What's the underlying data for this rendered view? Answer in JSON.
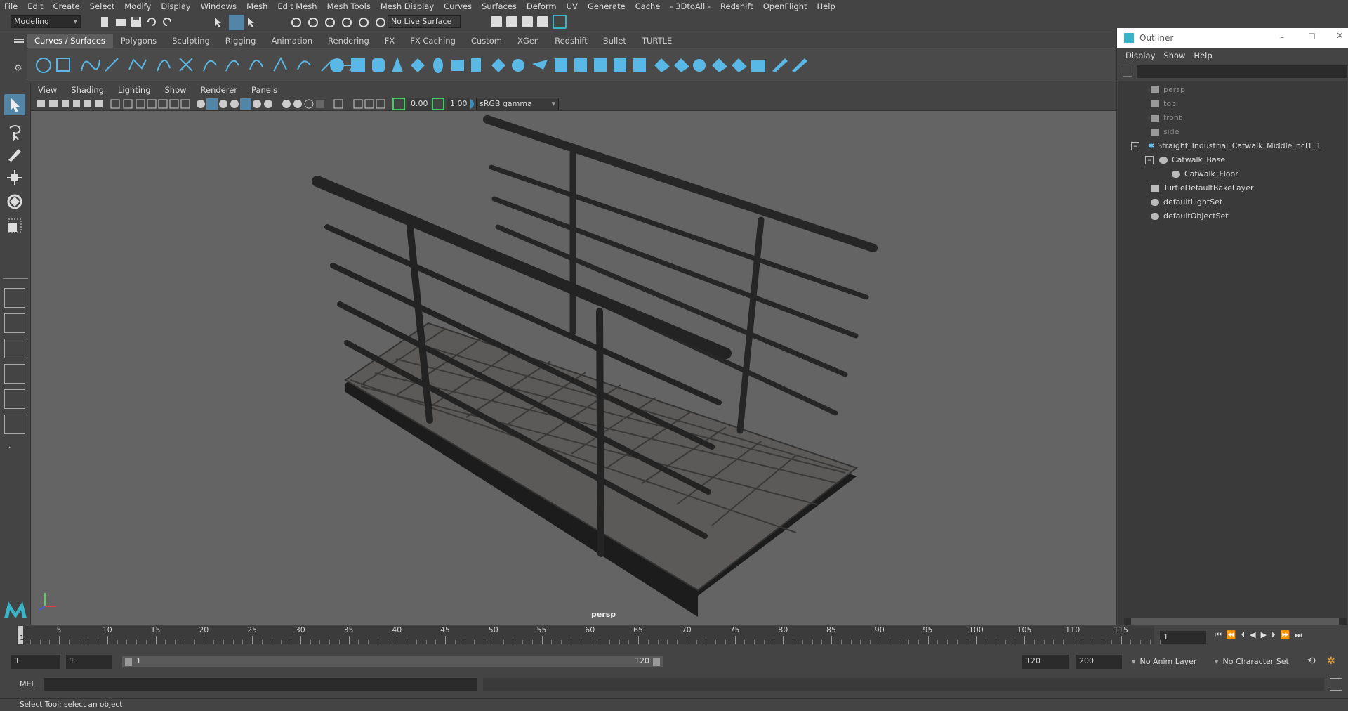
{
  "menu": [
    "File",
    "Edit",
    "Create",
    "Select",
    "Modify",
    "Display",
    "Windows",
    "Mesh",
    "Edit Mesh",
    "Mesh Tools",
    "Mesh Display",
    "Curves",
    "Surfaces",
    "Deform",
    "UV",
    "Generate",
    "Cache",
    "- 3DtoAll -",
    "Redshift",
    "OpenFlight",
    "Help"
  ],
  "status": {
    "mode": "Modeling",
    "live_surface": "No Live Surface"
  },
  "shelf_tabs": [
    "Curves / Surfaces",
    "Polygons",
    "Sculpting",
    "Rigging",
    "Animation",
    "Rendering",
    "FX",
    "FX Caching",
    "Custom",
    "XGen",
    "Redshift",
    "Bullet",
    "TURTLE"
  ],
  "shelf_active": "Curves / Surfaces",
  "viewport": {
    "menu": [
      "View",
      "Shading",
      "Lighting",
      "Show",
      "Renderer",
      "Panels"
    ],
    "exposure": "0.00",
    "gamma": "1.00",
    "color_space": "sRGB gamma",
    "camera_label": "persp"
  },
  "outliner": {
    "title": "Outliner",
    "menu": [
      "Display",
      "Show",
      "Help"
    ],
    "items": [
      {
        "label": "persp",
        "type": "camera"
      },
      {
        "label": "top",
        "type": "camera"
      },
      {
        "label": "front",
        "type": "camera"
      },
      {
        "label": "side",
        "type": "camera"
      },
      {
        "label": "Straight_Industrial_Catwalk_Middle_ncl1_1",
        "type": "group"
      },
      {
        "label": "Catwalk_Base",
        "type": "mesh"
      },
      {
        "label": "Catwalk_Floor",
        "type": "mesh"
      },
      {
        "label": "TurtleDefaultBakeLayer",
        "type": "layer"
      },
      {
        "label": "defaultLightSet",
        "type": "set"
      },
      {
        "label": "defaultObjectSet",
        "type": "set"
      }
    ]
  },
  "timeline": {
    "ticks": [
      "5",
      "10",
      "15",
      "20",
      "25",
      "30",
      "35",
      "40",
      "45",
      "50",
      "55",
      "60",
      "65",
      "70",
      "75",
      "80",
      "85",
      "90",
      "95",
      "100",
      "105",
      "110",
      "115"
    ],
    "current_frame_label": "1",
    "current_frame_field": "1"
  },
  "range": {
    "start": "1",
    "start2": "1",
    "slider_start": "1",
    "slider_end": "120",
    "end": "120",
    "end2": "200",
    "anim_layer": "No Anim Layer",
    "char_set": "No Character Set"
  },
  "cmd": {
    "label": "MEL"
  },
  "help": {
    "text": "Select Tool: select an object"
  },
  "colors": {
    "accent": "#5285a6",
    "active_icon": "#3ab5c8"
  }
}
